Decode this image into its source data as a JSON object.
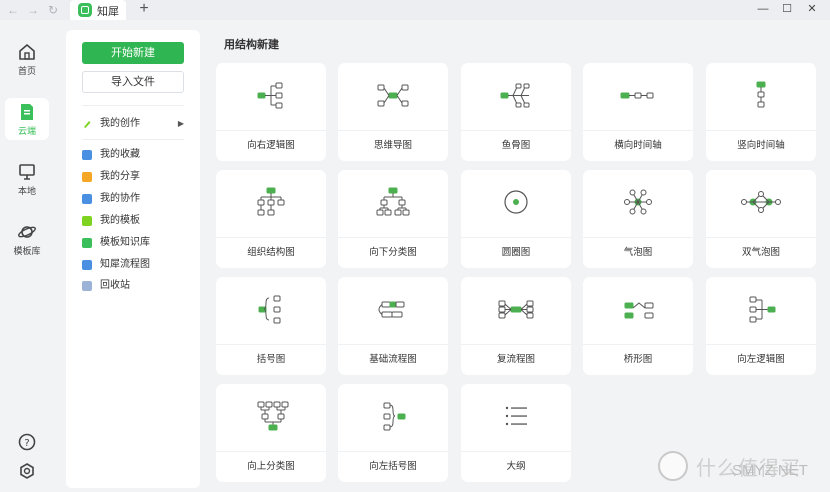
{
  "titlebar": {
    "tab_title": "知犀",
    "back_icon": "arrow-left-icon",
    "forward_icon": "arrow-right-icon",
    "refresh_icon": "refresh-icon"
  },
  "rail": {
    "items": [
      {
        "label": "首页",
        "icon": "home-icon"
      },
      {
        "label": "云端",
        "icon": "cloud-doc-icon",
        "active": true
      },
      {
        "label": "本地",
        "icon": "monitor-icon"
      },
      {
        "label": "模板库",
        "icon": "planet-icon"
      }
    ],
    "help_icon": "help-icon",
    "settings_icon": "settings-icon"
  },
  "panel": {
    "new_button": "开始新建",
    "import_button": "导入文件",
    "my_creations": "我的创作",
    "menu": [
      {
        "label": "我的收藏",
        "color": "#4a90e2"
      },
      {
        "label": "我的分享",
        "color": "#f5a623"
      },
      {
        "label": "我的协作",
        "color": "#4a90e2"
      },
      {
        "label": "我的模板",
        "color": "#7ed321"
      },
      {
        "label": "模板知识库",
        "color": "#3bbf5a"
      },
      {
        "label": "知犀流程图",
        "color": "#4a90e2"
      },
      {
        "label": "回收站",
        "color": "#9bb3d6"
      }
    ]
  },
  "main": {
    "title": "用结构新建",
    "cards": [
      {
        "label": "向右逻辑图",
        "icon": "right-logic-icon"
      },
      {
        "label": "思维导图",
        "icon": "mind-map-icon"
      },
      {
        "label": "鱼骨图",
        "icon": "fishbone-icon"
      },
      {
        "label": "横向时间轴",
        "icon": "horizontal-timeline-icon"
      },
      {
        "label": "竖向时间轴",
        "icon": "vertical-timeline-icon"
      },
      {
        "label": "组织结构图",
        "icon": "org-chart-icon"
      },
      {
        "label": "向下分类图",
        "icon": "down-tree-icon"
      },
      {
        "label": "圆圈图",
        "icon": "circle-map-icon"
      },
      {
        "label": "气泡图",
        "icon": "bubble-map-icon"
      },
      {
        "label": "双气泡图",
        "icon": "double-bubble-icon"
      },
      {
        "label": "括号图",
        "icon": "brace-map-icon"
      },
      {
        "label": "基础流程图",
        "icon": "basic-flow-icon"
      },
      {
        "label": "复流程图",
        "icon": "multi-flow-icon"
      },
      {
        "label": "桥形图",
        "icon": "bridge-map-icon"
      },
      {
        "label": "向左逻辑图",
        "icon": "left-logic-icon"
      },
      {
        "label": "向上分类图",
        "icon": "up-tree-icon"
      },
      {
        "label": "向左括号图",
        "icon": "left-brace-icon"
      },
      {
        "label": "大纲",
        "icon": "outline-icon"
      }
    ]
  },
  "watermark": {
    "text": "什么值得买",
    "sub": "SMYZ.NET"
  },
  "colors": {
    "accent": "#2fb551",
    "node": "#4caf50"
  }
}
